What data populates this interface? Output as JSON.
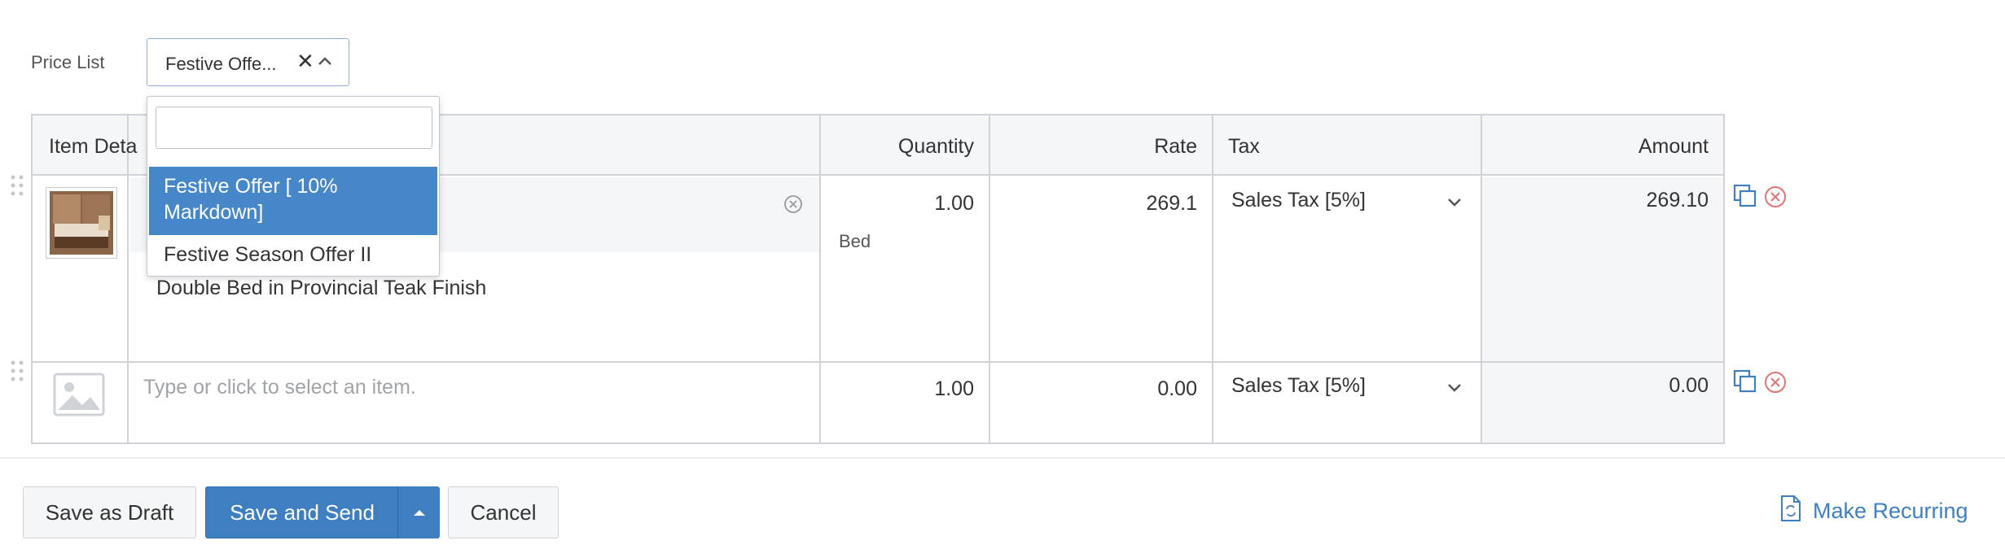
{
  "price_list": {
    "label": "Price List",
    "value": "Festive Offe...",
    "clear_glyph": "✕",
    "options": [
      "Festive Offer [ 10% Markdown]",
      "Festive Season Offer II"
    ],
    "selected_index": 0,
    "search_placeholder": ""
  },
  "table": {
    "headers": {
      "item": "Item Deta",
      "quantity": "Quantity",
      "rate": "Rate",
      "tax": "Tax",
      "amount": "Amount"
    },
    "rows": [
      {
        "description": "Double Bed in Provincial Teak Finish",
        "quantity": "1.00",
        "unit": "Bed",
        "rate": "269.1",
        "tax": "Sales Tax [5%]",
        "amount": "269.10"
      },
      {
        "item_placeholder": "Type or click to select an item.",
        "quantity": "1.00",
        "rate": "0.00",
        "tax": "Sales Tax [5%]",
        "amount": "0.00"
      }
    ]
  },
  "footer": {
    "save_draft": "Save as Draft",
    "save_send": "Save and Send",
    "cancel": "Cancel",
    "make_recurring": "Make Recurring"
  },
  "colors": {
    "primary": "#3d7fc1",
    "selected_option": "#4587c9",
    "border": "#cfd3d8",
    "delete": "#e57373"
  },
  "icons": [
    "drag-handle-icon",
    "clear-circle-icon",
    "chevron-down-icon",
    "copy-icon",
    "remove-circle-icon",
    "image-placeholder-icon",
    "recurring-document-icon",
    "caret-up-icon"
  ]
}
